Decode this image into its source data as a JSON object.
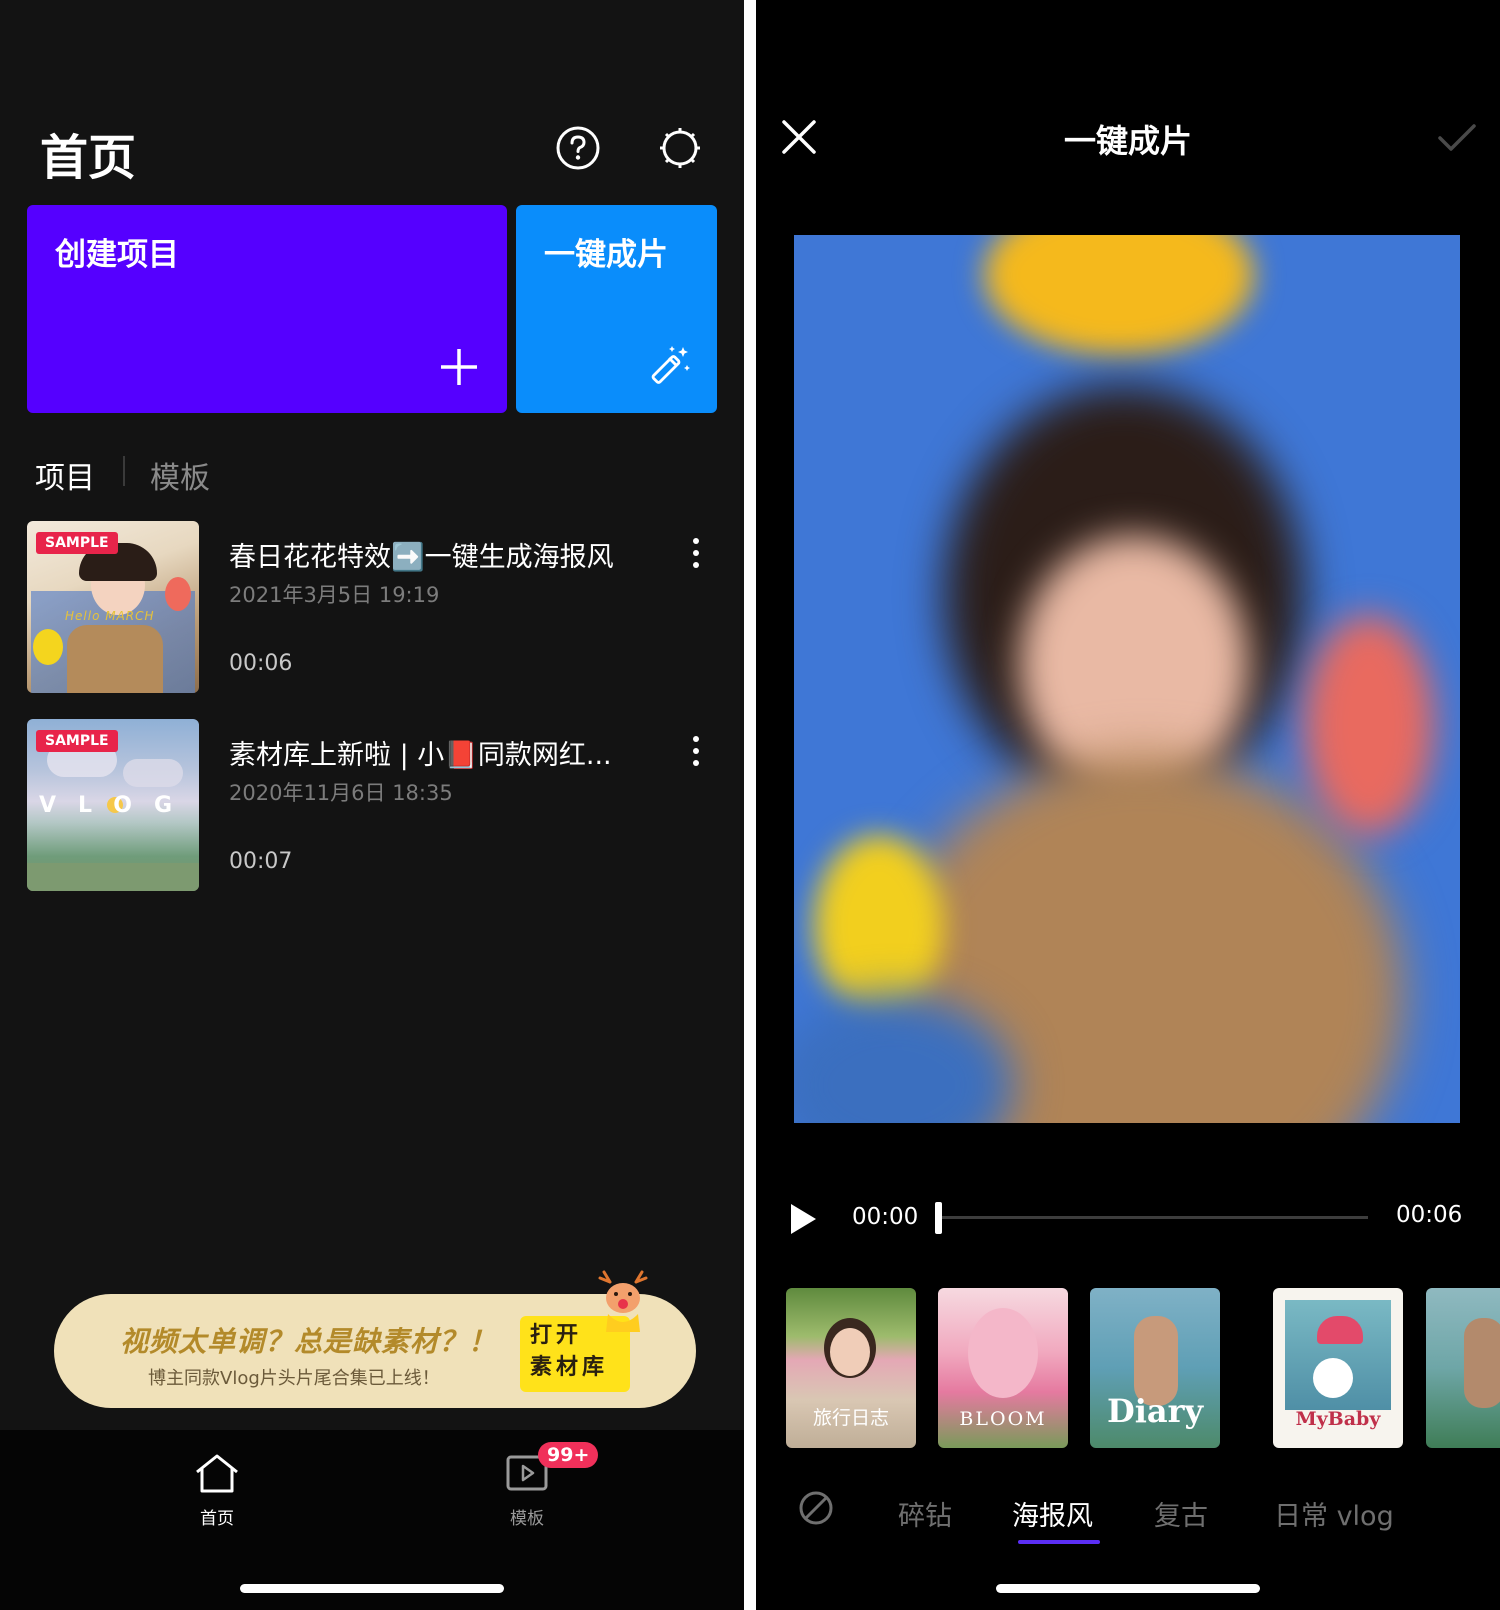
{
  "home": {
    "title": "首页",
    "icons": {
      "help": "help-circle-icon",
      "settings": "gear-icon"
    },
    "create_card": {
      "label": "创建项目",
      "color": "#5500ff",
      "icon": "plus-icon"
    },
    "quick_card": {
      "label": "一键成片",
      "color": "#0a8dfb",
      "icon": "magic-wand-icon"
    },
    "tabs": [
      {
        "label": "项目",
        "active": true
      },
      {
        "label": "模板",
        "active": false
      }
    ],
    "projects": [
      {
        "badge": "SAMPLE",
        "title": "春日花花特效➡️一键生成海报风",
        "date": "2021年3月5日 19:19",
        "duration": "00:06",
        "thumb_caption": "Hello MARCH"
      },
      {
        "badge": "SAMPLE",
        "title": "素材库上新啦 | 小📕同款网红...",
        "date": "2020年11月6日 18:35",
        "duration": "00:07",
        "thumb_caption": "VLOG"
      }
    ],
    "banner": {
      "headline": "视频太单调？总是缺素材？！",
      "subline": "博主同款Vlog片头片尾合集已上线！",
      "button_line1": "打开",
      "button_line2": "素材库"
    },
    "nav": [
      {
        "label": "首页",
        "icon": "home-icon",
        "active": true
      },
      {
        "label": "模板",
        "icon": "template-play-icon",
        "badge": "99+"
      }
    ]
  },
  "editor": {
    "title": "一键成片",
    "icons": {
      "close": "close-icon",
      "confirm": "check-icon",
      "play": "play-icon",
      "none": "none-icon"
    },
    "playback": {
      "current": "00:00",
      "total": "00:06",
      "progress": 0.0
    },
    "templates": [
      {
        "caption": "旅行日志"
      },
      {
        "caption": "BLOOM"
      },
      {
        "caption": "Diary"
      },
      {
        "caption": "MyBaby"
      },
      {
        "caption": ""
      }
    ],
    "filters": [
      {
        "label": "碎钻",
        "active": false
      },
      {
        "label": "海报风",
        "active": true
      },
      {
        "label": "复古",
        "active": false
      },
      {
        "label": "日常 vlog",
        "active": false
      }
    ],
    "accent_color": "#5b2ef5"
  }
}
